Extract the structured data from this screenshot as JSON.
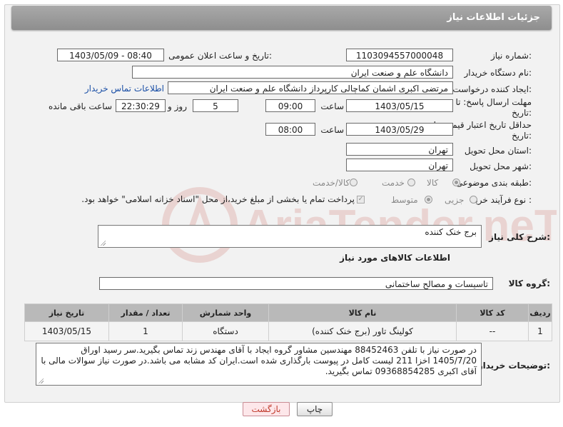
{
  "header": {
    "title": "جزئیات اطلاعات نیاز"
  },
  "fields": {
    "need_number_label": "شماره نیاز:",
    "need_number": "1103094557000048",
    "announce_label": "تاریخ و ساعت اعلان عمومی:",
    "announce_value": "1403/05/09 - 08:40",
    "buyer_org_label": "نام دستگاه خریدار:",
    "buyer_org": "دانشگاه علم و صنعت ایران",
    "creator_label": "ایجاد کننده درخواست:",
    "creator": "مرتضی اکبری اشمان کماچالی کارپرداز دانشگاه علم و صنعت ایران",
    "contact_link": "اطلاعات تماس خریدار",
    "send_deadline_label_1": "مهلت ارسال پاسخ: تا",
    "send_deadline_label_2": "تاریخ:",
    "send_date": "1403/05/15",
    "time_label": "ساعت",
    "send_time": "09:00",
    "days_value": "5",
    "days_label": "روز و",
    "remaining_time": "22:30:29",
    "remaining_label": "ساعت باقی مانده",
    "price_deadline_label_1": "حداقل تاریخ اعتبار قیمت: تا",
    "price_deadline_label_2": "تاریخ:",
    "price_date": "1403/05/29",
    "price_time": "08:00",
    "province_label": "استان محل تحویل:",
    "province": "تهران",
    "city_label": "شهر محل تحویل:",
    "city": "تهران",
    "category_label": "طبقه بندی موضوعی:",
    "category_options": [
      "کالا",
      "خدمت",
      "کالا/خدمت"
    ],
    "process_label": "نوع فرآیند خرید :",
    "process_options": [
      "جزیی",
      "متوسط"
    ],
    "payment_note": "پرداخت تمام یا بخشی از مبلغ خرید،از محل \"اسناد خزانه اسلامی\" خواهد بود."
  },
  "summary": {
    "label": "شرح کلی نیاز:",
    "text": "برج خنک کننده"
  },
  "goods": {
    "section_title": "اطلاعات کالاهای مورد نیاز",
    "group_label": "گروه کالا:",
    "group_value": "تاسیسات و مصالح ساختمانی"
  },
  "table": {
    "headers": [
      "ردیف",
      "کد کالا",
      "نام کالا",
      "واحد شمارش",
      "تعداد / مقدار",
      "تاریخ نیاز"
    ],
    "rows": [
      [
        "1",
        "--",
        "کولینگ تاور (برج خنک کننده)",
        "دستگاه",
        "1",
        "1403/05/15"
      ]
    ]
  },
  "buyer_notes": {
    "label": "توضیحات خریدار:",
    "text": "در صورت نیاز با تلفن 88452463 مهندسین مشاور گروه ایجاد با آقای مهندس زند تماس بگیرید.سر رسید اوراق 1405/7/20 اخزا 211 لیست کامل در پیوست بارگذاری شده است.ایران کد مشابه می باشد.در صورت نیاز سوالات مالی با آقای اکبری 09368854285 تماس بگیرید."
  },
  "buttons": {
    "print": "چاپ",
    "back": "بازگشت"
  },
  "watermark": {
    "text": "AriaTender.neT"
  },
  "colors": {
    "header": "#999999",
    "link": "#1a4fa6",
    "back_button_text": "#c0392b",
    "table_header": "#b9b9b9"
  }
}
